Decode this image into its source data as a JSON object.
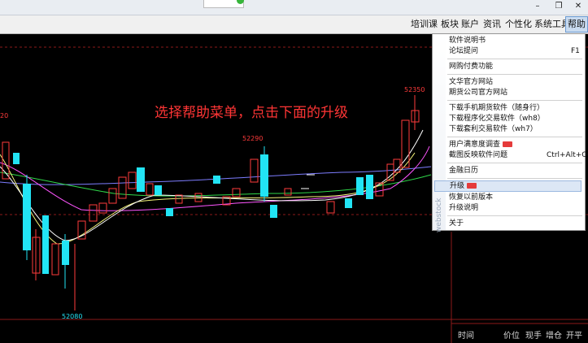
{
  "menu": {
    "items": [
      "培训课",
      "板块",
      "账户",
      "资讯",
      "个性化",
      "系统工具",
      "帮助"
    ]
  },
  "dropdown": {
    "items": [
      {
        "label": "软件说明书",
        "shortcut": ""
      },
      {
        "label": "论坛提问",
        "shortcut": "F1"
      },
      {
        "label": "网购付费功能",
        "shortcut": ""
      },
      {
        "label": "文华官方网站",
        "shortcut": ""
      },
      {
        "label": "期货公司官方网站",
        "shortcut": ""
      },
      {
        "label": "下载手机期货软件（随身行）",
        "shortcut": ""
      },
      {
        "label": "下载程序化交易软件（wh8）",
        "shortcut": ""
      },
      {
        "label": "下载套利交易软件（wh7）",
        "shortcut": ""
      },
      {
        "label": "用户满意度调查",
        "shortcut": ""
      },
      {
        "label": "截图反映软件问题",
        "shortcut": "Ctrl+Alt+O"
      },
      {
        "label": "金融日历",
        "shortcut": ""
      },
      {
        "label": "升级",
        "shortcut": ""
      },
      {
        "label": "恢复以前版本",
        "shortcut": ""
      },
      {
        "label": "升级说明",
        "shortcut": ""
      },
      {
        "label": "关于",
        "shortcut": ""
      }
    ],
    "side_text": "webstock"
  },
  "annotation": "选择帮助菜单，点击下面的升级",
  "price_labels": {
    "left_edge": "20",
    "top_right": "52350",
    "peak": "52290",
    "low": "52080"
  },
  "footer": {
    "time": "时间",
    "price": "价位",
    "current": "现手",
    "change": "增仓",
    "open_close": "开平"
  },
  "colors": {
    "up": "#ff3b3b",
    "down": "#22e4f5",
    "annotation": "#ff3535",
    "arrow": "#ff2a1e"
  },
  "chart_data": {
    "type": "candlestick",
    "labels": [
      "20",
      "52350",
      "52290",
      "52080"
    ]
  }
}
